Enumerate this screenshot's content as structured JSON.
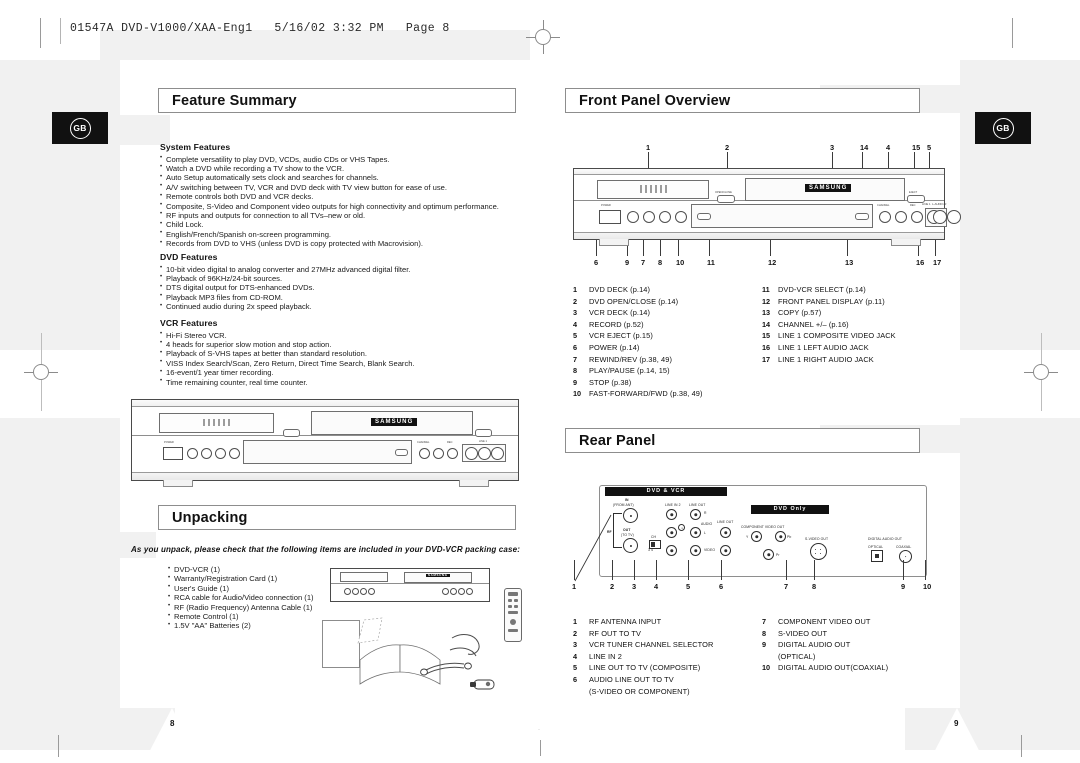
{
  "document": {
    "slug": "01547A DVD-V1000/XAA-Eng1   5/16/02 3:32 PM   Page 8",
    "badge_left": "GB",
    "badge_right": "GB",
    "page_number_left": "8",
    "page_number_right": "9",
    "brand": "SAMSUNG"
  },
  "feature_summary": {
    "title": "Feature Summary",
    "groups": [
      {
        "heading": "System Features",
        "items": [
          "Complete versatility to play DVD, VCDs, audio CDs or VHS Tapes.",
          "Watch a DVD while recording a TV show to the VCR.",
          "Auto Setup automatically sets clock and searches for channels.",
          "A/V switching between TV, VCR and DVD deck with TV view button for ease of use.",
          "Remote controls both DVD and VCR decks.",
          "Composite, S-Video and Component video outputs for high connectivity and optimum performance.",
          "RF inputs and outputs for connection to all TVs–new or old.",
          "Child Lock.",
          "English/French/Spanish on-screen programming.",
          "Records from DVD to VHS (unless DVD is copy protected with Macrovision)."
        ]
      },
      {
        "heading": "DVD Features",
        "items": [
          "10-bit video digital to analog converter and 27MHz advanced digital filter.",
          "Playback of 96KHz/24-bit sources.",
          "DTS digital output for DTS-enhanced DVDs.",
          "Playback MP3 files from CD-ROM.",
          "Continued audio during 2x speed playback."
        ]
      },
      {
        "heading": "VCR Features",
        "items": [
          "Hi-Fi Stereo VCR.",
          "4 heads for superior slow motion and stop action.",
          "Playback of S-VHS tapes at better than standard resolution.",
          "VISS Index Search/Scan, Zero Return, Direct Time Search, Blank Search.",
          "16-event/1 year timer recording.",
          "Time remaining counter, real time counter."
        ]
      }
    ]
  },
  "unpacking": {
    "title": "Unpacking",
    "lead": "As you unpack, please check that the following items are included in your DVD-VCR packing case:",
    "items": [
      "DVD-VCR (1)",
      "Warranty/Registration Card (1)",
      "User's Guide (1)",
      "RCA cable for Audio/Video connection (1)",
      "RF (Radio Frequency) Antenna Cable (1)",
      "Remote Control (1)",
      "1.5V \"AA\" Batteries (2)"
    ]
  },
  "front_panel": {
    "title": "Front Panel Overview",
    "callouts_top": [
      "1",
      "2",
      "3",
      "14",
      "4",
      "15",
      "5"
    ],
    "callouts_bottom": [
      "6",
      "9",
      "7",
      "8",
      "10",
      "11",
      "12",
      "13",
      "16",
      "17"
    ],
    "legend_left": [
      {
        "n": "1",
        "label": "DVD DECK (p.14)"
      },
      {
        "n": "2",
        "label": "DVD OPEN/CLOSE (p.14)"
      },
      {
        "n": "3",
        "label": "VCR DECK (p.14)"
      },
      {
        "n": "4",
        "label": "RECORD (p.52)"
      },
      {
        "n": "5",
        "label": "VCR EJECT (p.15)"
      },
      {
        "n": "6",
        "label": "POWER (p.14)"
      },
      {
        "n": "7",
        "label": "REWIND/REV (p.38, 49)"
      },
      {
        "n": "8",
        "label": "PLAY/PAUSE (p.14, 15)"
      },
      {
        "n": "9",
        "label": "STOP (p.38)"
      },
      {
        "n": "10",
        "label": "FAST-FORWARD/FWD (p.38, 49)"
      }
    ],
    "legend_right": [
      {
        "n": "11",
        "label": "DVD-VCR SELECT (p.14)"
      },
      {
        "n": "12",
        "label": "FRONT PANEL DISPLAY (p.11)"
      },
      {
        "n": "13",
        "label": "COPY (p.57)"
      },
      {
        "n": "14",
        "label": "CHANNEL +/– (p.16)"
      },
      {
        "n": "15",
        "label": "LINE 1 COMPOSITE VIDEO JACK"
      },
      {
        "n": "16",
        "label": "LINE 1 LEFT AUDIO JACK"
      },
      {
        "n": "17",
        "label": "LINE 1 RIGHT AUDIO JACK"
      }
    ],
    "panel_labels": [
      "POWER",
      "CHANNEL",
      "REC",
      "VIDEO",
      "LINE 1",
      "L-AUDIO-R",
      "EJECT",
      "OPEN/CLOSE",
      "SELECT",
      "COPY"
    ]
  },
  "rear_panel": {
    "title": "Rear Panel",
    "section_dvd_vcr": "DVD & VCR",
    "section_dvd_only": "DVD Only",
    "art_labels": {
      "in": "IN",
      "from_ant": "(FROM ANT)",
      "rf": "RF",
      "out": "OUT",
      "to_tv": "(TO TV)",
      "line_in_2": "LINE IN 2",
      "line_out": "LINE OUT",
      "audio": "AUDIO",
      "video": "VIDEO",
      "r": "R",
      "l": "L",
      "ch_switch": "CH",
      "ch_opts": "3 4",
      "component_video_out": "COMPONENT VIDEO OUT",
      "s_video_out": "S-VIDEO OUT",
      "digital_audio_out": "DIGITAL AUDIO OUT",
      "optical": "OPTICAL",
      "coaxial": "COAXIAL",
      "y": "Y",
      "pb": "Pb",
      "pr": "Pr"
    },
    "callouts": [
      "1",
      "2",
      "3",
      "4",
      "5",
      "6",
      "7",
      "8",
      "9",
      "10"
    ],
    "legend_left": [
      {
        "n": "1",
        "label": "RF ANTENNA INPUT"
      },
      {
        "n": "2",
        "label": "RF OUT TO TV"
      },
      {
        "n": "3",
        "label": "VCR TUNER CHANNEL SELECTOR"
      },
      {
        "n": "4",
        "label": "LINE IN 2"
      },
      {
        "n": "5",
        "label": "LINE OUT TO TV (COMPOSITE)"
      },
      {
        "n": "6",
        "label": "AUDIO LINE OUT TO TV"
      },
      {
        "n": "",
        "label": "(S-VIDEO OR COMPONENT)"
      }
    ],
    "legend_right": [
      {
        "n": "7",
        "label": "COMPONENT VIDEO OUT"
      },
      {
        "n": "8",
        "label": "S-VIDEO OUT"
      },
      {
        "n": "9",
        "label": "DIGITAL AUDIO OUT"
      },
      {
        "n": "",
        "label": "(OPTICAL)"
      },
      {
        "n": "10",
        "label": "DIGITAL AUDIO OUT(COAXIAL)"
      }
    ]
  }
}
